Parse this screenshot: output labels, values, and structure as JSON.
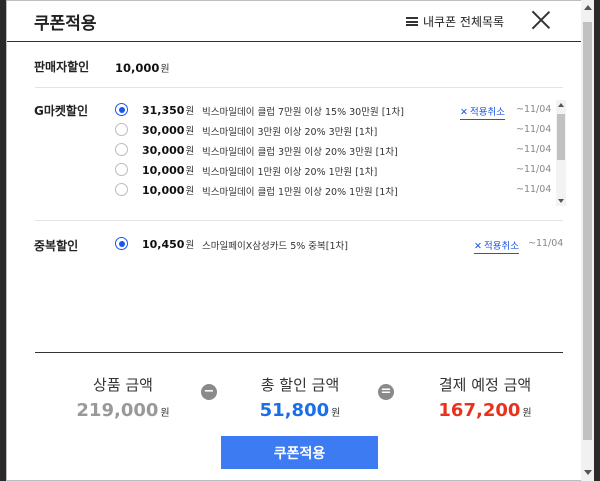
{
  "modal": {
    "title": "쿠폰적용",
    "my_coupon_list": "내쿠폰 전체목록"
  },
  "seller_discount": {
    "label": "판매자할인",
    "amount": "10,000",
    "unit": "원"
  },
  "gmarket_discount": {
    "label": "G마켓할인",
    "coupons": [
      {
        "selected": true,
        "amount": "31,350",
        "unit": "원",
        "desc": "빅스마일데이 클럽 7만원 이상 15% 30만원 [1차]",
        "cancel": "적용취소",
        "date": "~11/04"
      },
      {
        "selected": false,
        "amount": "30,000",
        "unit": "원",
        "desc": "빅스마일데이 3만원 이상 20% 3만원 [1차]",
        "cancel": "",
        "date": "~11/04"
      },
      {
        "selected": false,
        "amount": "30,000",
        "unit": "원",
        "desc": "빅스마일데이 클럽 3만원 이상 20% 3만원 [1차]",
        "cancel": "",
        "date": "~11/04"
      },
      {
        "selected": false,
        "amount": "10,000",
        "unit": "원",
        "desc": "빅스마일데이 1만원 이상 20% 1만원 [1차]",
        "cancel": "",
        "date": "~11/04"
      },
      {
        "selected": false,
        "amount": "10,000",
        "unit": "원",
        "desc": "빅스마일데이 클럽 1만원 이상 20% 1만원 [1차]",
        "cancel": "",
        "date": "~11/04"
      }
    ]
  },
  "duplicate_discount": {
    "label": "중복할인",
    "coupon": {
      "selected": true,
      "amount": "10,450",
      "unit": "원",
      "desc": "스마일페이X삼성카드 5% 중복[1차]",
      "cancel": "적용취소",
      "date": "~11/04"
    }
  },
  "summary": {
    "product": {
      "label": "상품 금액",
      "value": "219,000",
      "unit": "원",
      "color": "#999999"
    },
    "minus": "−",
    "discount": {
      "label": "총 할인 금액",
      "value": "51,800",
      "unit": "원",
      "color": "#1a6fe6"
    },
    "equals": "=",
    "payment": {
      "label": "결제 예정 금액",
      "value": "167,200",
      "unit": "원",
      "color": "#e8321e"
    }
  },
  "apply_button": "쿠폰적용"
}
